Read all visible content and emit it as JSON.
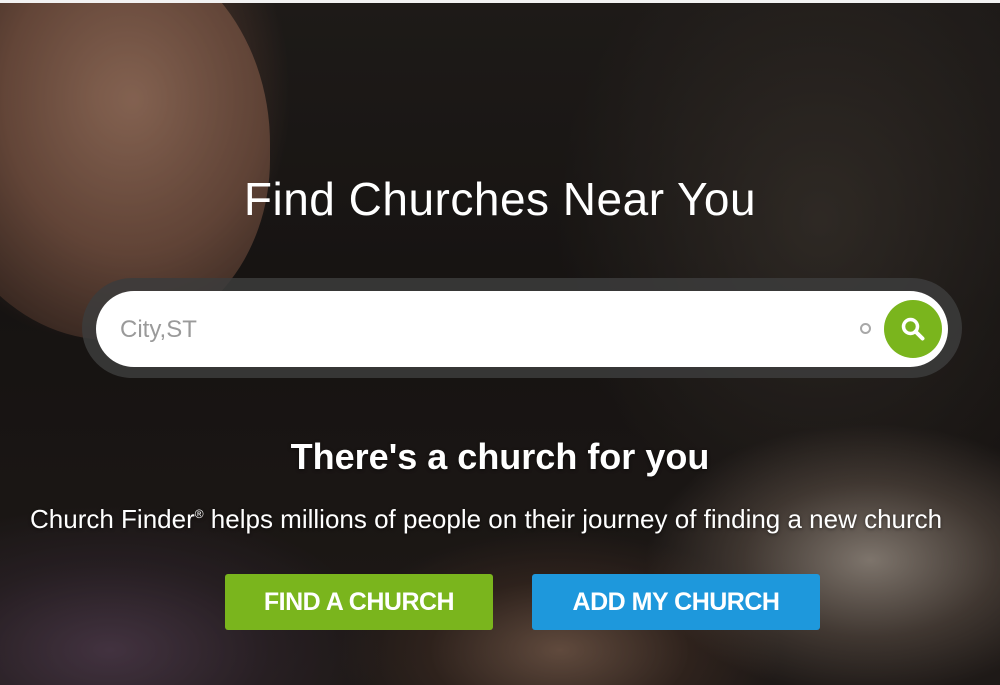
{
  "hero": {
    "headline": "Find Churches Near You",
    "search": {
      "placeholder": "City,ST",
      "value": "",
      "button_icon": "search-icon",
      "indicator_icon": "circle-icon"
    },
    "tagline": "There's a church for you",
    "description_brand": "Church Finder",
    "description_registered": "®",
    "description_rest": " helps millions of people on their journey of finding a new church",
    "buttons": {
      "find_label": "FIND A CHURCH",
      "add_label": "ADD MY CHURCH"
    }
  },
  "colors": {
    "accent_green": "#7ab51d",
    "accent_blue": "#1e98dc",
    "text": "#ffffff"
  }
}
